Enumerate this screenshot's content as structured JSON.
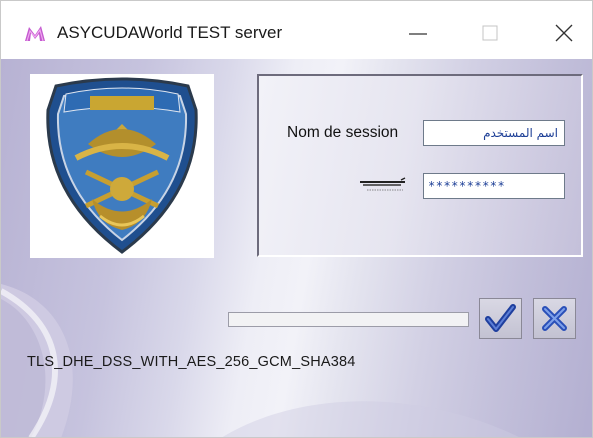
{
  "window": {
    "title": "ASYCUDAWorld TEST server"
  },
  "titlebar": {
    "app_icon": "asycuda-logo-icon",
    "minimize_icon": "minimize-icon",
    "maximize_icon": "maximize-icon",
    "close_icon": "close-icon"
  },
  "logo": {
    "emblem": "customs-emblem-icon"
  },
  "login": {
    "session_label": "Nom de session",
    "session_value": "اسم المستخدم",
    "password_label_icon": "arabic-password-label-graphic",
    "password_value": "**********"
  },
  "progress": {
    "value": 0
  },
  "actions": {
    "ok_icon": "checkmark-icon",
    "cancel_icon": "x-icon"
  },
  "status": {
    "cipher": "TLS_DHE_DSS_WITH_AES_256_GCM_SHA384"
  },
  "colors": {
    "accent_check": "#1f3f9e",
    "accent_cancel": "#2a4fb8",
    "panel_gradient_light": "#f2f2f8",
    "panel_gradient_dark": "#b3afd1"
  }
}
